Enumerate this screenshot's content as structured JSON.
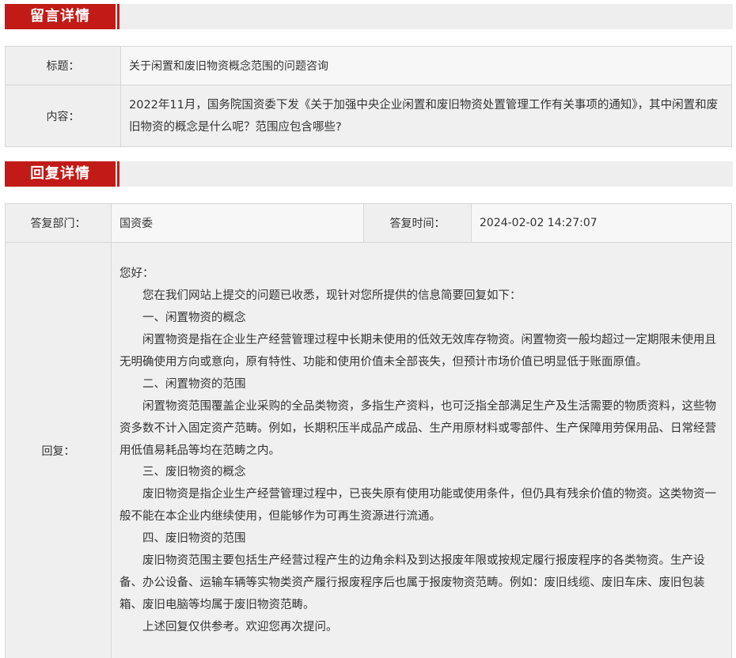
{
  "message_section": {
    "heading": "留言详情",
    "title_label": "标题：",
    "title_value": "关于闲置和废旧物资概念范围的问题咨询",
    "content_label": "内容：",
    "content_value": "2022年11月，国务院国资委下发《关于加强中央企业闲置和废旧物资处置管理工作有关事项的通知》，其中闲置和废旧物资的概念是什么呢？范围应包含哪些?"
  },
  "reply_section": {
    "heading": "回复详情",
    "dept_label": "答复部门：",
    "dept_value": "国资委",
    "time_label": "答复时间：",
    "time_value": "2024-02-02 14:27:07",
    "reply_label": "回复：",
    "reply_paragraphs": [
      "您好：",
      "您在我们网站上提交的问题已收悉，现针对您所提供的信息简要回复如下：",
      "一、闲置物资的概念",
      "闲置物资是指在企业生产经营管理过程中长期未使用的低效无效库存物资。闲置物资一般均超过一定期限未使用且无明确使用方向或意向，原有特性、功能和使用价值未全部丧失，但预计市场价值已明显低于账面原值。",
      "二、闲置物资的范围",
      "闲置物资范围覆盖企业采购的全品类物资，多指生产资料，也可泛指全部满足生产及生活需要的物质资料，这些物资多数不计入固定资产范畴。例如，长期积压半成品产成品、生产用原材料或零部件、生产保障用劳保用品、日常经营用低值易耗品等均在范畴之内。",
      "三、废旧物资的概念",
      "废旧物资是指企业生产经营管理过程中，已丧失原有使用功能或使用条件，但仍具有残余价值的物资。这类物资一般不能在本企业内继续使用，但能够作为可再生资源进行流通。",
      "四、废旧物资的范围",
      "废旧物资范围主要包括生产经营过程产生的边角余料及到达报废年限或按规定履行报废程序的各类物资。生产设备、办公设备、运输车辆等实物类资产履行报废程序后也属于报废物资范畴。例如：废旧线缆、废旧车床、废旧包装箱、废旧电脑等均属于废旧物资范畴。",
      "上述回复仅供参考。欢迎您再次提问。"
    ]
  }
}
